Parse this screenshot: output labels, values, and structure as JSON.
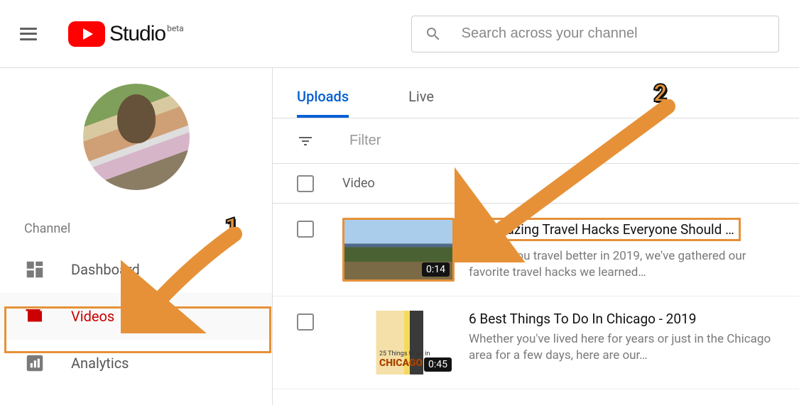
{
  "header": {
    "brand": "Studio",
    "brand_suffix": "beta",
    "search_placeholder": "Search across your channel"
  },
  "sidebar": {
    "label": "Channel",
    "items": [
      {
        "label": "Dashboard"
      },
      {
        "label": "Videos"
      },
      {
        "label": "Analytics"
      }
    ]
  },
  "tabs": {
    "uploads": "Uploads",
    "live": "Live"
  },
  "filter": {
    "placeholder": "Filter"
  },
  "columns": {
    "video": "Video"
  },
  "videos": [
    {
      "title": "4 Amazing Travel Hacks Everyone Should …",
      "desc": "To help you travel better in 2019, we've gathered our favorite travel hacks we learned…",
      "duration": "0:14"
    },
    {
      "title": "6 Best Things To Do In Chicago - 2019",
      "desc": "Whether you've lived here for years or just in the Chicago area for a few days, here are our…",
      "duration": "0:45"
    }
  ],
  "annotations": {
    "one": "1",
    "two": "2"
  }
}
